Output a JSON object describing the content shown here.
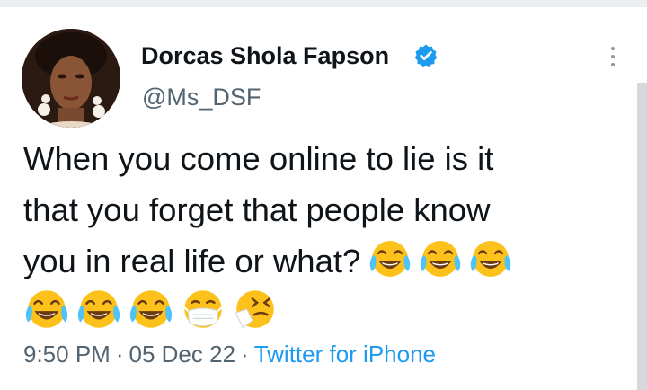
{
  "tweet": {
    "author_name": "Dorcas Shola Fapson",
    "author_handle": "@Ms_DSF",
    "text_lines": [
      "When you come online to lie is it",
      "that you forget that people know",
      "you in real life or what?"
    ],
    "emojis_line3": [
      "face-with-tears-of-joy",
      "face-with-tears-of-joy",
      "face-with-tears-of-joy"
    ],
    "emojis_line4": [
      "face-with-tears-of-joy",
      "face-with-tears-of-joy",
      "face-with-tears-of-joy",
      "face-with-medical-mask",
      "sneezing-face"
    ],
    "time": "9:50 PM",
    "separator": "·",
    "date": "05 Dec 22",
    "source": "Twitter for iPhone",
    "verified": true
  },
  "colors": {
    "text": "#0f1419",
    "secondary": "#536471",
    "accent": "#1d9bf0"
  }
}
